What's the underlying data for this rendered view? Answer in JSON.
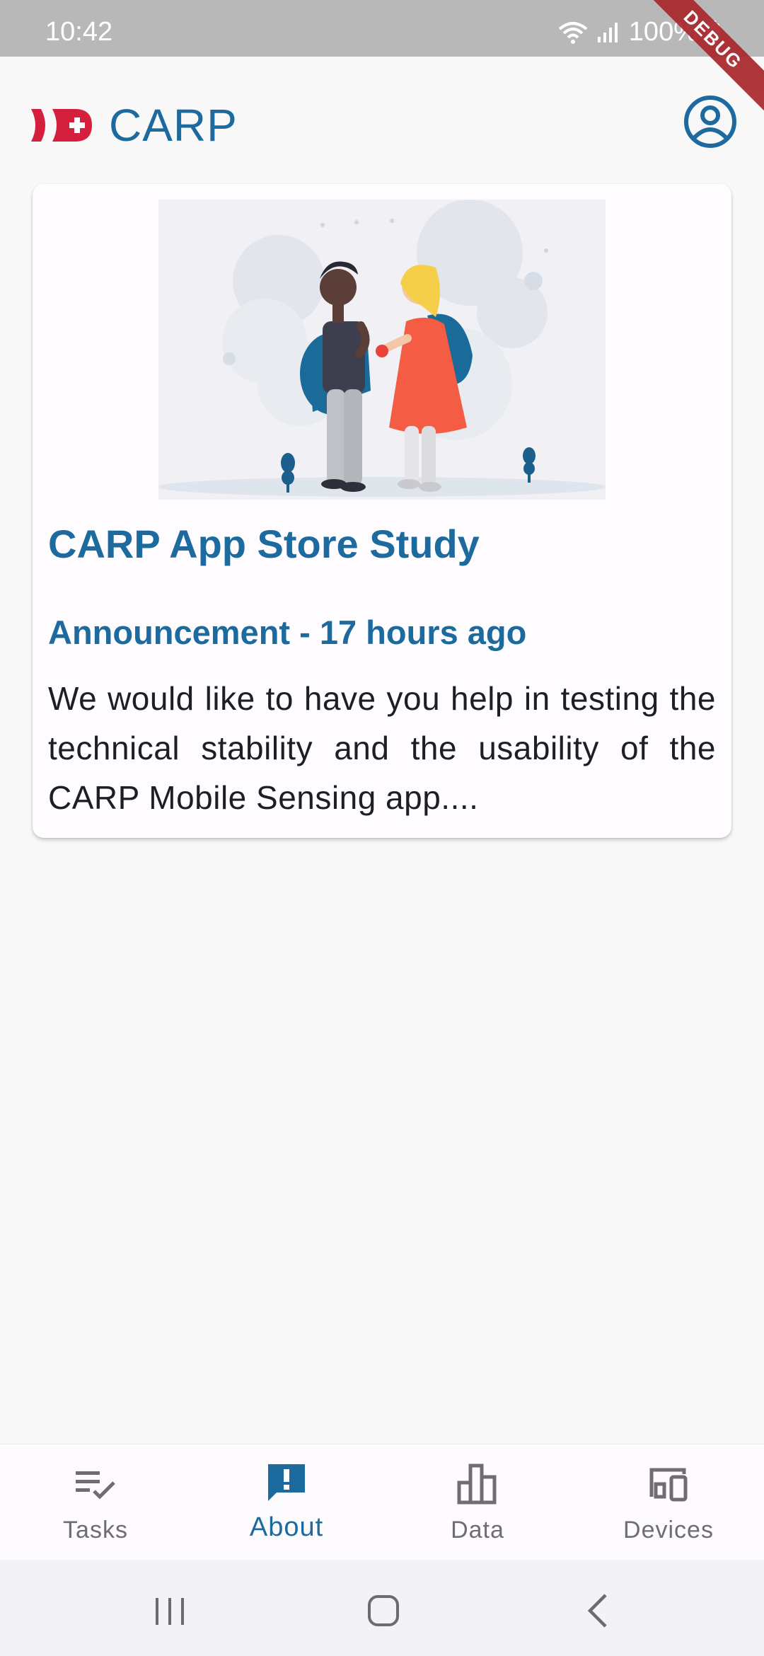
{
  "status_bar": {
    "time": "10:42",
    "battery": "100%",
    "debug_banner": "DEBUG"
  },
  "app_bar": {
    "logo_text": "CARP",
    "profile_icon": "account-circle-icon"
  },
  "card": {
    "title": "CARP App Store Study",
    "subtitle": "Announcement - 17 hours ago",
    "body": "We would like to have you help in testing the technical stability and the usability of the CARP Mobile Sensing app...."
  },
  "bottom_nav": {
    "items": [
      {
        "label": "Tasks",
        "icon": "tasks-icon",
        "active": false
      },
      {
        "label": "About",
        "icon": "announcement-icon",
        "active": true
      },
      {
        "label": "Data",
        "icon": "bar-chart-icon",
        "active": false
      },
      {
        "label": "Devices",
        "icon": "devices-icon",
        "active": false
      }
    ]
  },
  "colors": {
    "primary": "#1d6a9f",
    "accent_red": "#d41f3d",
    "background": "#f8f8f9",
    "status_bar": "#b8b8b8"
  }
}
